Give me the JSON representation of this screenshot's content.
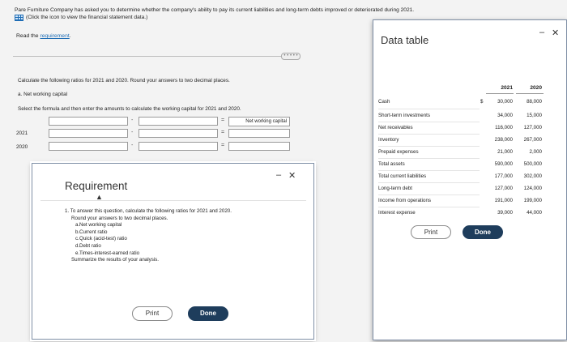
{
  "intro": {
    "line1": "Pare Furniture Company has asked you to determine whether the company's ability to pay its current liabilities and long-term debts improved or deteriorated during 2021.",
    "line2": "(Click the icon to view the financial statement data.)",
    "icon": "table-grid-icon"
  },
  "read_req": {
    "prefix": "Read the ",
    "link": "requirement",
    "suffix": "."
  },
  "more_pill": "• • • • •",
  "question": {
    "line1": "Calculate the following ratios for 2021 and 2020. Round your answers to two decimal places.",
    "line2": "a. Net working capital",
    "line3": "Select the formula and then enter the amounts to calculate the working capital for 2021 and 2020."
  },
  "wc": {
    "minus": "-",
    "equals": "=",
    "result_header": "Net working capital",
    "rows": [
      "2021",
      "2020"
    ]
  },
  "requirement_popup": {
    "title": "Requirement",
    "min": "–",
    "close": "✕",
    "intro": "1.  To answer this question, calculate the following ratios for 2021 and 2020.",
    "intro2": "Round your answers to two decimal places.",
    "items": [
      {
        "letter": "a.",
        "text": "Net working capital"
      },
      {
        "letter": "b.",
        "text": "Current ratio"
      },
      {
        "letter": "c.",
        "text": "Quick (acid-test) ratio"
      },
      {
        "letter": "d.",
        "text": "Debt ratio"
      },
      {
        "letter": "e.",
        "text": "Times-interest-earned ratio"
      }
    ],
    "summary": "Summarize the results of your analysis.",
    "print": "Print",
    "done": "Done"
  },
  "data_popup": {
    "title": "Data table",
    "min": "–",
    "close": "✕",
    "years": [
      "2021",
      "2020"
    ],
    "dollar": "$",
    "rows": [
      {
        "label": "Cash",
        "v2021": "30,000",
        "v2020": "88,000"
      },
      {
        "label": "Short-term investments",
        "v2021": "34,000",
        "v2020": "15,000"
      },
      {
        "label": "Net receivables",
        "v2021": "116,000",
        "v2020": "127,000"
      },
      {
        "label": "Inventory",
        "v2021": "238,000",
        "v2020": "267,000"
      },
      {
        "label": "Prepaid expenses",
        "v2021": "21,000",
        "v2020": "2,000"
      },
      {
        "label": "Total assets",
        "v2021": "590,000",
        "v2020": "500,000"
      },
      {
        "label": "Total current liabilities",
        "v2021": "177,000",
        "v2020": "302,000"
      },
      {
        "label": "Long-term debt",
        "v2021": "127,000",
        "v2020": "124,000"
      },
      {
        "label": "Income from operations",
        "v2021": "191,000",
        "v2020": "199,000"
      },
      {
        "label": "Interest expense",
        "v2021": "39,000",
        "v2020": "44,000"
      }
    ],
    "print": "Print",
    "done": "Done"
  }
}
